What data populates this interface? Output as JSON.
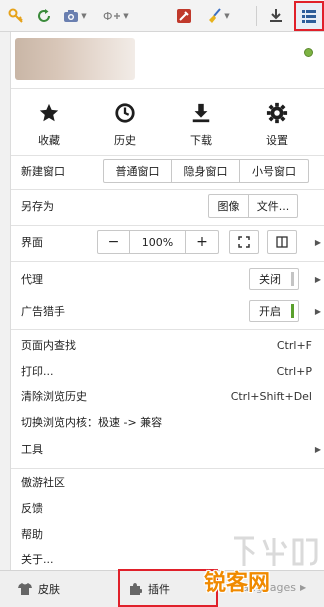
{
  "toolbar": {
    "icons": [
      "key-icon",
      "refresh-icon",
      "camera-icon",
      "translate-icon",
      "toolbox-icon",
      "broom-icon",
      "download-icon",
      "menu-list-icon"
    ],
    "accent_highlight": "#e0202a"
  },
  "quick_actions": [
    {
      "label": "收藏",
      "icon": "star-icon"
    },
    {
      "label": "历史",
      "icon": "clock-icon"
    },
    {
      "label": "下载",
      "icon": "download-icon"
    },
    {
      "label": "设置",
      "icon": "gear-icon"
    }
  ],
  "new_window": {
    "label": "新建窗口",
    "options": [
      "普通窗口",
      "隐身窗口",
      "小号窗口"
    ]
  },
  "save_as": {
    "label": "另存为",
    "options": [
      "图像",
      "文件..."
    ]
  },
  "zoom": {
    "label": "界面",
    "minus": "−",
    "value": "100%",
    "plus": "+"
  },
  "proxy": {
    "label": "代理",
    "state": "关闭",
    "indicator_color": "#bdbdbd"
  },
  "adblock": {
    "label": "广告猎手",
    "state": "开启",
    "indicator_color": "#5aa02c"
  },
  "actions": [
    {
      "label": "页面内查找",
      "shortcut": "Ctrl+F"
    },
    {
      "label": "打印...",
      "shortcut": "Ctrl+P"
    },
    {
      "label": "清除浏览历史",
      "shortcut": "Ctrl+Shift+Del"
    },
    {
      "label": "切换浏览内核：极速 -> 兼容",
      "shortcut": ""
    }
  ],
  "tools": {
    "label": "工具"
  },
  "links": [
    "傲游社区",
    "反馈",
    "帮助",
    "关于..."
  ],
  "bottom_bar": {
    "skin": "皮肤",
    "plugins": "插件",
    "languages": "Languages"
  },
  "watermark": {
    "text": "锐客网",
    "ghost": "下载吧"
  }
}
